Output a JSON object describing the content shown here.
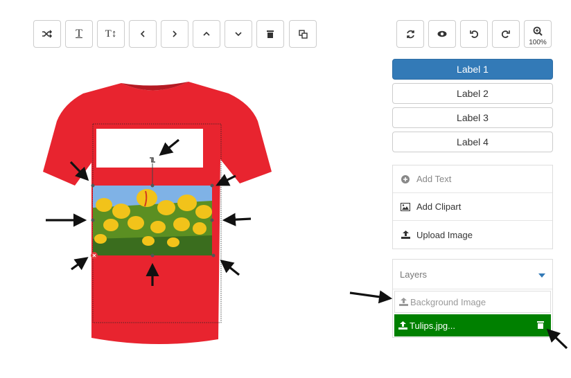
{
  "toolbar": {
    "left_buttons": [
      "shuffle-icon",
      "text-underline-icon",
      "text-size-icon",
      "chevron-left-icon",
      "chevron-right-icon",
      "chevron-up-icon",
      "chevron-down-icon",
      "trash-icon",
      "copy-icon"
    ],
    "text_size_label": "T↕",
    "text_label": "T",
    "right_buttons": [
      "refresh-icon",
      "eye-icon",
      "undo-icon",
      "redo-icon",
      "zoom-in-icon"
    ],
    "zoom_label": "100%"
  },
  "labels": [
    "Label 1",
    "Label 2",
    "Label 3",
    "Label 4"
  ],
  "actions": {
    "add_text": "Add Text",
    "add_clipart": "Add Clipart",
    "upload_image": "Upload Image"
  },
  "layers": {
    "title": "Layers",
    "background": "Background Image",
    "item": "Tulips.jpg..."
  },
  "colors": {
    "primary": "#337ab7",
    "shirt": "#e8242f",
    "layer_active": "#008000",
    "arrow": "#111111"
  }
}
